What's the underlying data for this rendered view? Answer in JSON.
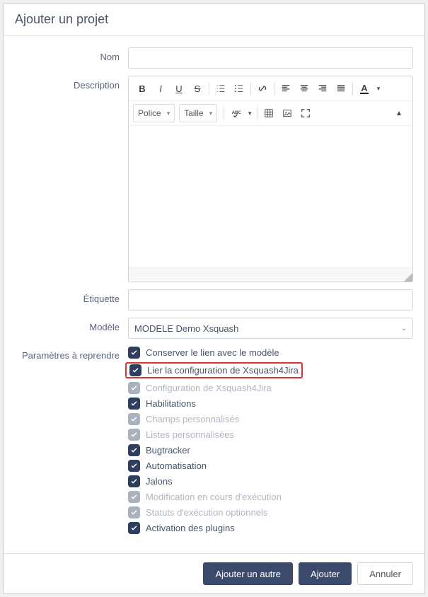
{
  "dialog": {
    "title": "Ajouter un projet"
  },
  "labels": {
    "name": "Nom",
    "description": "Description",
    "tag": "Étiquette",
    "model": "Modèle",
    "params": "Paramètres à reprendre"
  },
  "fields": {
    "name_value": "",
    "tag_value": "",
    "model_selected": "MODELE Demo Xsquash"
  },
  "toolbar": {
    "font_label": "Police",
    "size_label": "Taille"
  },
  "params_items": [
    {
      "label": "Conserver le lien avec le modèle",
      "checked": true,
      "disabled": false,
      "highlight": false
    },
    {
      "label": "Lier la configuration de Xsquash4Jira",
      "checked": true,
      "disabled": false,
      "highlight": true
    },
    {
      "label": "Configuration de Xsquash4Jira",
      "checked": true,
      "disabled": true,
      "highlight": false
    },
    {
      "label": "Habilitations",
      "checked": true,
      "disabled": false,
      "highlight": false
    },
    {
      "label": "Champs personnalisés",
      "checked": true,
      "disabled": true,
      "highlight": false
    },
    {
      "label": "Listes personnalisées",
      "checked": true,
      "disabled": true,
      "highlight": false
    },
    {
      "label": "Bugtracker",
      "checked": true,
      "disabled": false,
      "highlight": false
    },
    {
      "label": "Automatisation",
      "checked": true,
      "disabled": false,
      "highlight": false
    },
    {
      "label": "Jalons",
      "checked": true,
      "disabled": false,
      "highlight": false
    },
    {
      "label": "Modification en cours d'exécution",
      "checked": true,
      "disabled": true,
      "highlight": false
    },
    {
      "label": "Statuts d'exécution optionnels",
      "checked": true,
      "disabled": true,
      "highlight": false
    },
    {
      "label": "Activation des plugins",
      "checked": true,
      "disabled": false,
      "highlight": false
    }
  ],
  "buttons": {
    "add_another": "Ajouter un autre",
    "add": "Ajouter",
    "cancel": "Annuler"
  }
}
